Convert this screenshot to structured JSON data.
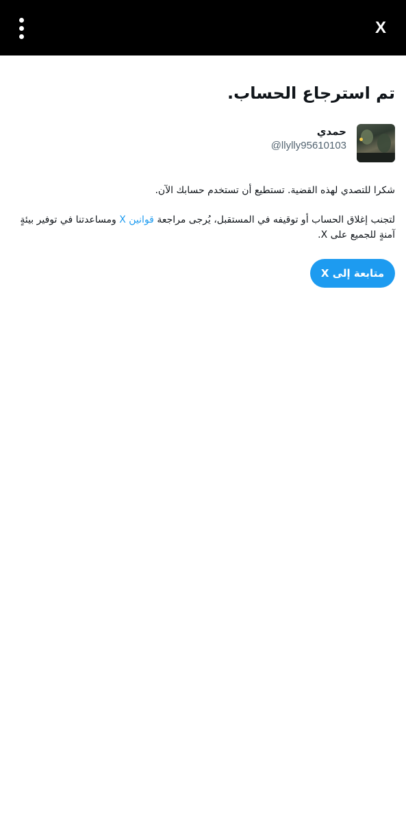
{
  "topbar": {
    "menu_icon": "more-vertical-icon",
    "close_label": "X",
    "background": "#000000"
  },
  "main": {
    "title": "تم استرجاع الحساب.",
    "profile": {
      "display_name": "حمدي",
      "handle": "@llylly95610103"
    },
    "message_1": "شكرا للتصدي لهذه القضية. تستطيع أن تستخدم حسابك الآن.",
    "message_2_before": "لتجنب إغلاق الحساب أو توقيفه في المستقبل، يُرجى مراجعة ",
    "message_2_link": "قوانين X",
    "message_2_after": " ومساعدتنا في توفير بيئةٍ آمنةٍ للجميع على X.",
    "continue_button": "متابعة إلى X"
  },
  "colors": {
    "accent": "#1d9bf0",
    "text": "#0f1419",
    "muted": "#536471"
  }
}
